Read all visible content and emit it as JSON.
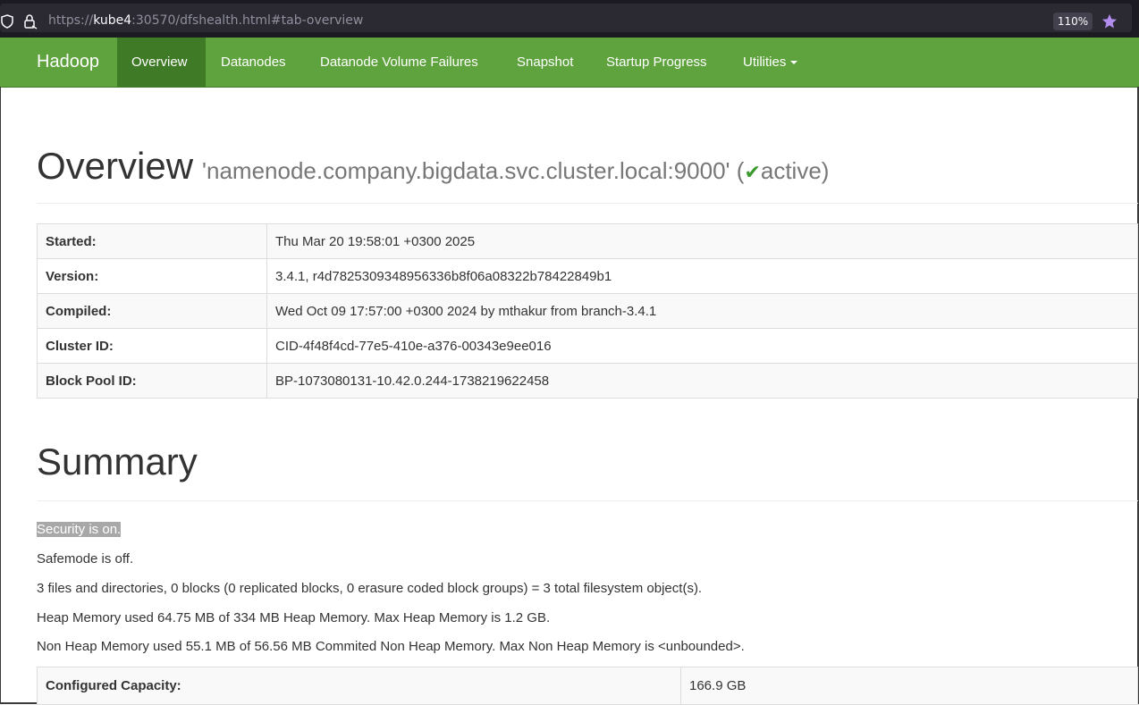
{
  "browser": {
    "url_prefix": "https://",
    "url_host": "kube4",
    "url_rest": ":30570/dfshealth.html#tab-overview",
    "zoom": "110%"
  },
  "navbar": {
    "brand": "Hadoop",
    "items": [
      {
        "label": "Overview",
        "active": true
      },
      {
        "label": "Datanodes"
      },
      {
        "label": "Datanode Volume Failures"
      },
      {
        "label": "Snapshot"
      },
      {
        "label": "Startup Progress"
      },
      {
        "label": "Utilities"
      }
    ]
  },
  "overview": {
    "title": "Overview",
    "host": "'namenode.company.bigdata.svc.cluster.local:9000'",
    "status_open": "(",
    "status": "active",
    "status_close": ")",
    "rows": [
      {
        "key": "Started:",
        "value": "Thu Mar 20 19:58:01 +0300 2025"
      },
      {
        "key": "Version:",
        "value": "3.4.1, r4d7825309348956336b8f06a08322b78422849b1"
      },
      {
        "key": "Compiled:",
        "value": "Wed Oct 09 17:57:00 +0300 2024 by mthakur from branch-3.4.1"
      },
      {
        "key": "Cluster ID:",
        "value": "CID-4f48f4cd-77e5-410e-a376-00343e9ee016"
      },
      {
        "key": "Block Pool ID:",
        "value": "BP-1073080131-10.42.0.244-1738219622458"
      }
    ]
  },
  "summary": {
    "title": "Summary",
    "security": "Security is on.",
    "safemode": "Safemode is off.",
    "files": "3 files and directories, 0 blocks (0 replicated blocks, 0 erasure coded block groups) = 3 total filesystem object(s).",
    "heap": "Heap Memory used 64.75 MB of 334 MB Heap Memory. Max Heap Memory is 1.2 GB.",
    "nonheap": "Non Heap Memory used 55.1 MB of 56.56 MB Commited Non Heap Memory. Max Non Heap Memory is <unbounded>.",
    "capacity_key": "Configured Capacity:",
    "capacity_value": "166.9 GB"
  }
}
